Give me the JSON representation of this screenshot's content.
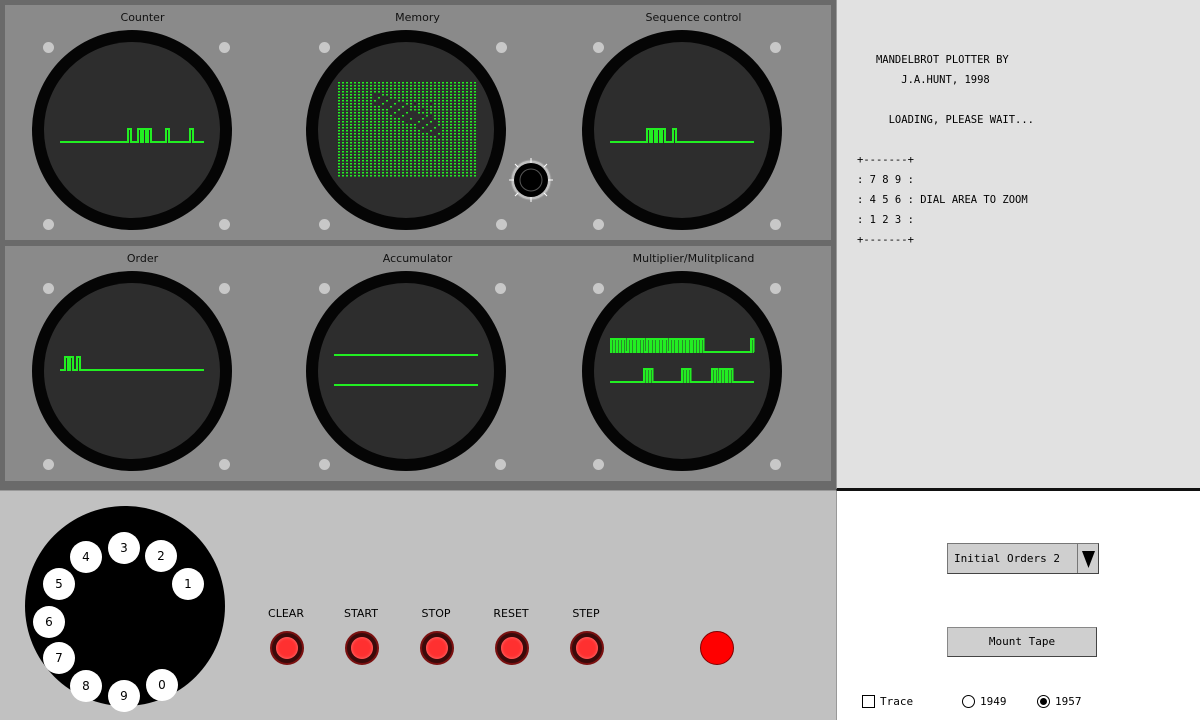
{
  "scopes": {
    "counter_title": "Counter",
    "memory_title": "Memory",
    "sequence_title": "Sequence control",
    "order_title": "Order",
    "accumulator_title": "Accumulator",
    "multiplier_title": "Multiplier/Mulitplicand",
    "trace_color": "#22ee22"
  },
  "tape": {
    "line1": "   MANDELBROT PLOTTER BY",
    "line2": "       J.A.HUNT, 1998",
    "line3": "",
    "line4": "     LOADING, PLEASE WAIT...",
    "line5": "",
    "line6": "+-------+",
    "line7": ": 7 8 9 :",
    "line8": ": 4 5 6 : DIAL AREA TO ZOOM",
    "line9": ": 1 2 3 :",
    "line10": "+-------+"
  },
  "dial": {
    "digits": [
      "1",
      "2",
      "3",
      "4",
      "5",
      "6",
      "7",
      "8",
      "9",
      "0"
    ]
  },
  "controls": {
    "clear_label": "CLEAR",
    "start_label": "START",
    "stop_label": "STOP",
    "reset_label": "RESET",
    "step_label": "STEP",
    "lamp_color": "#ff0000"
  },
  "side": {
    "orders_select": "Initial Orders 2",
    "mount_tape_label": "Mount Tape",
    "trace_label": "Trace",
    "trace_checked": false,
    "radio_1949_label": "1949",
    "radio_1957_label": "1957",
    "selected_year": "1957"
  }
}
